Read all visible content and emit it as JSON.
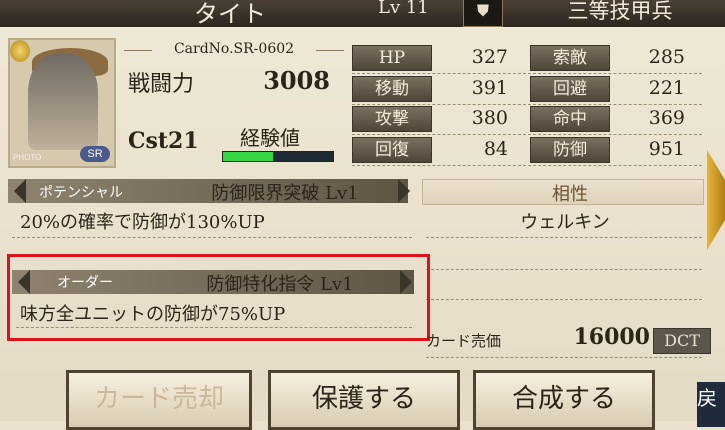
{
  "topbar": {
    "name": "タイト",
    "level": "Lv 11",
    "icon": "shield-icon",
    "class": "三等技甲兵"
  },
  "card": {
    "number": "CardNo.SR-0602",
    "rarity": "SR",
    "photo_label": "PHOTO",
    "power_label": "戦闘力",
    "power_value": "3008",
    "cost": "Cst21",
    "exp_label": "経験値",
    "exp_progress": 0.45
  },
  "stats": [
    {
      "label": "HP",
      "value": "327"
    },
    {
      "label": "索敵",
      "value": "285"
    },
    {
      "label": "移動",
      "value": "391"
    },
    {
      "label": "回避",
      "value": "221"
    },
    {
      "label": "攻撃",
      "value": "380"
    },
    {
      "label": "命中",
      "value": "369"
    },
    {
      "label": "回復",
      "value": "84"
    },
    {
      "label": "防御",
      "value": "951"
    }
  ],
  "potential": {
    "tag": "ポテンシャル",
    "title": "防御限界突破 Lv1",
    "desc": "20%の確率で防御が130%UP"
  },
  "affinity": {
    "title": "相性",
    "name": "ウェルキン"
  },
  "order": {
    "tag": "オーダー",
    "title": "防御特化指令 Lv1",
    "desc": "味方全ユニットの防御が75%UP"
  },
  "sale": {
    "label": "カード売価",
    "value": "16000",
    "unit": "DCT"
  },
  "buttons": {
    "sell": "カード売却",
    "protect": "保護する",
    "combine": "合成する",
    "corner": "戻"
  },
  "colors": {
    "highlight": "#d9141a",
    "exp_fill": "#35d645"
  }
}
